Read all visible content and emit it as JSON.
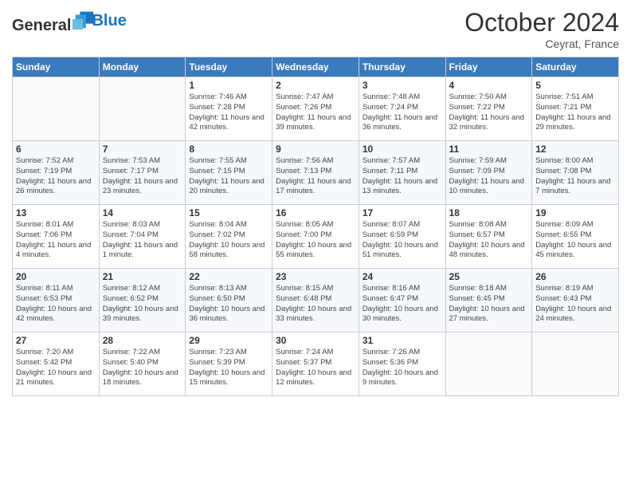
{
  "header": {
    "logo_line1": "General",
    "logo_line2": "Blue",
    "month": "October 2024",
    "location": "Ceyrat, France"
  },
  "weekdays": [
    "Sunday",
    "Monday",
    "Tuesday",
    "Wednesday",
    "Thursday",
    "Friday",
    "Saturday"
  ],
  "weeks": [
    [
      {
        "day": "",
        "info": ""
      },
      {
        "day": "",
        "info": ""
      },
      {
        "day": "1",
        "info": "Sunrise: 7:46 AM\nSunset: 7:28 PM\nDaylight: 11 hours and 42 minutes."
      },
      {
        "day": "2",
        "info": "Sunrise: 7:47 AM\nSunset: 7:26 PM\nDaylight: 11 hours and 39 minutes."
      },
      {
        "day": "3",
        "info": "Sunrise: 7:48 AM\nSunset: 7:24 PM\nDaylight: 11 hours and 36 minutes."
      },
      {
        "day": "4",
        "info": "Sunrise: 7:50 AM\nSunset: 7:22 PM\nDaylight: 11 hours and 32 minutes."
      },
      {
        "day": "5",
        "info": "Sunrise: 7:51 AM\nSunset: 7:21 PM\nDaylight: 11 hours and 29 minutes."
      }
    ],
    [
      {
        "day": "6",
        "info": "Sunrise: 7:52 AM\nSunset: 7:19 PM\nDaylight: 11 hours and 26 minutes."
      },
      {
        "day": "7",
        "info": "Sunrise: 7:53 AM\nSunset: 7:17 PM\nDaylight: 11 hours and 23 minutes."
      },
      {
        "day": "8",
        "info": "Sunrise: 7:55 AM\nSunset: 7:15 PM\nDaylight: 11 hours and 20 minutes."
      },
      {
        "day": "9",
        "info": "Sunrise: 7:56 AM\nSunset: 7:13 PM\nDaylight: 11 hours and 17 minutes."
      },
      {
        "day": "10",
        "info": "Sunrise: 7:57 AM\nSunset: 7:11 PM\nDaylight: 11 hours and 13 minutes."
      },
      {
        "day": "11",
        "info": "Sunrise: 7:59 AM\nSunset: 7:09 PM\nDaylight: 11 hours and 10 minutes."
      },
      {
        "day": "12",
        "info": "Sunrise: 8:00 AM\nSunset: 7:08 PM\nDaylight: 11 hours and 7 minutes."
      }
    ],
    [
      {
        "day": "13",
        "info": "Sunrise: 8:01 AM\nSunset: 7:06 PM\nDaylight: 11 hours and 4 minutes."
      },
      {
        "day": "14",
        "info": "Sunrise: 8:03 AM\nSunset: 7:04 PM\nDaylight: 11 hours and 1 minute."
      },
      {
        "day": "15",
        "info": "Sunrise: 8:04 AM\nSunset: 7:02 PM\nDaylight: 10 hours and 58 minutes."
      },
      {
        "day": "16",
        "info": "Sunrise: 8:05 AM\nSunset: 7:00 PM\nDaylight: 10 hours and 55 minutes."
      },
      {
        "day": "17",
        "info": "Sunrise: 8:07 AM\nSunset: 6:59 PM\nDaylight: 10 hours and 51 minutes."
      },
      {
        "day": "18",
        "info": "Sunrise: 8:08 AM\nSunset: 6:57 PM\nDaylight: 10 hours and 48 minutes."
      },
      {
        "day": "19",
        "info": "Sunrise: 8:09 AM\nSunset: 6:55 PM\nDaylight: 10 hours and 45 minutes."
      }
    ],
    [
      {
        "day": "20",
        "info": "Sunrise: 8:11 AM\nSunset: 6:53 PM\nDaylight: 10 hours and 42 minutes."
      },
      {
        "day": "21",
        "info": "Sunrise: 8:12 AM\nSunset: 6:52 PM\nDaylight: 10 hours and 39 minutes."
      },
      {
        "day": "22",
        "info": "Sunrise: 8:13 AM\nSunset: 6:50 PM\nDaylight: 10 hours and 36 minutes."
      },
      {
        "day": "23",
        "info": "Sunrise: 8:15 AM\nSunset: 6:48 PM\nDaylight: 10 hours and 33 minutes."
      },
      {
        "day": "24",
        "info": "Sunrise: 8:16 AM\nSunset: 6:47 PM\nDaylight: 10 hours and 30 minutes."
      },
      {
        "day": "25",
        "info": "Sunrise: 8:18 AM\nSunset: 6:45 PM\nDaylight: 10 hours and 27 minutes."
      },
      {
        "day": "26",
        "info": "Sunrise: 8:19 AM\nSunset: 6:43 PM\nDaylight: 10 hours and 24 minutes."
      }
    ],
    [
      {
        "day": "27",
        "info": "Sunrise: 7:20 AM\nSunset: 5:42 PM\nDaylight: 10 hours and 21 minutes."
      },
      {
        "day": "28",
        "info": "Sunrise: 7:22 AM\nSunset: 5:40 PM\nDaylight: 10 hours and 18 minutes."
      },
      {
        "day": "29",
        "info": "Sunrise: 7:23 AM\nSunset: 5:39 PM\nDaylight: 10 hours and 15 minutes."
      },
      {
        "day": "30",
        "info": "Sunrise: 7:24 AM\nSunset: 5:37 PM\nDaylight: 10 hours and 12 minutes."
      },
      {
        "day": "31",
        "info": "Sunrise: 7:26 AM\nSunset: 5:36 PM\nDaylight: 10 hours and 9 minutes."
      },
      {
        "day": "",
        "info": ""
      },
      {
        "day": "",
        "info": ""
      }
    ]
  ]
}
